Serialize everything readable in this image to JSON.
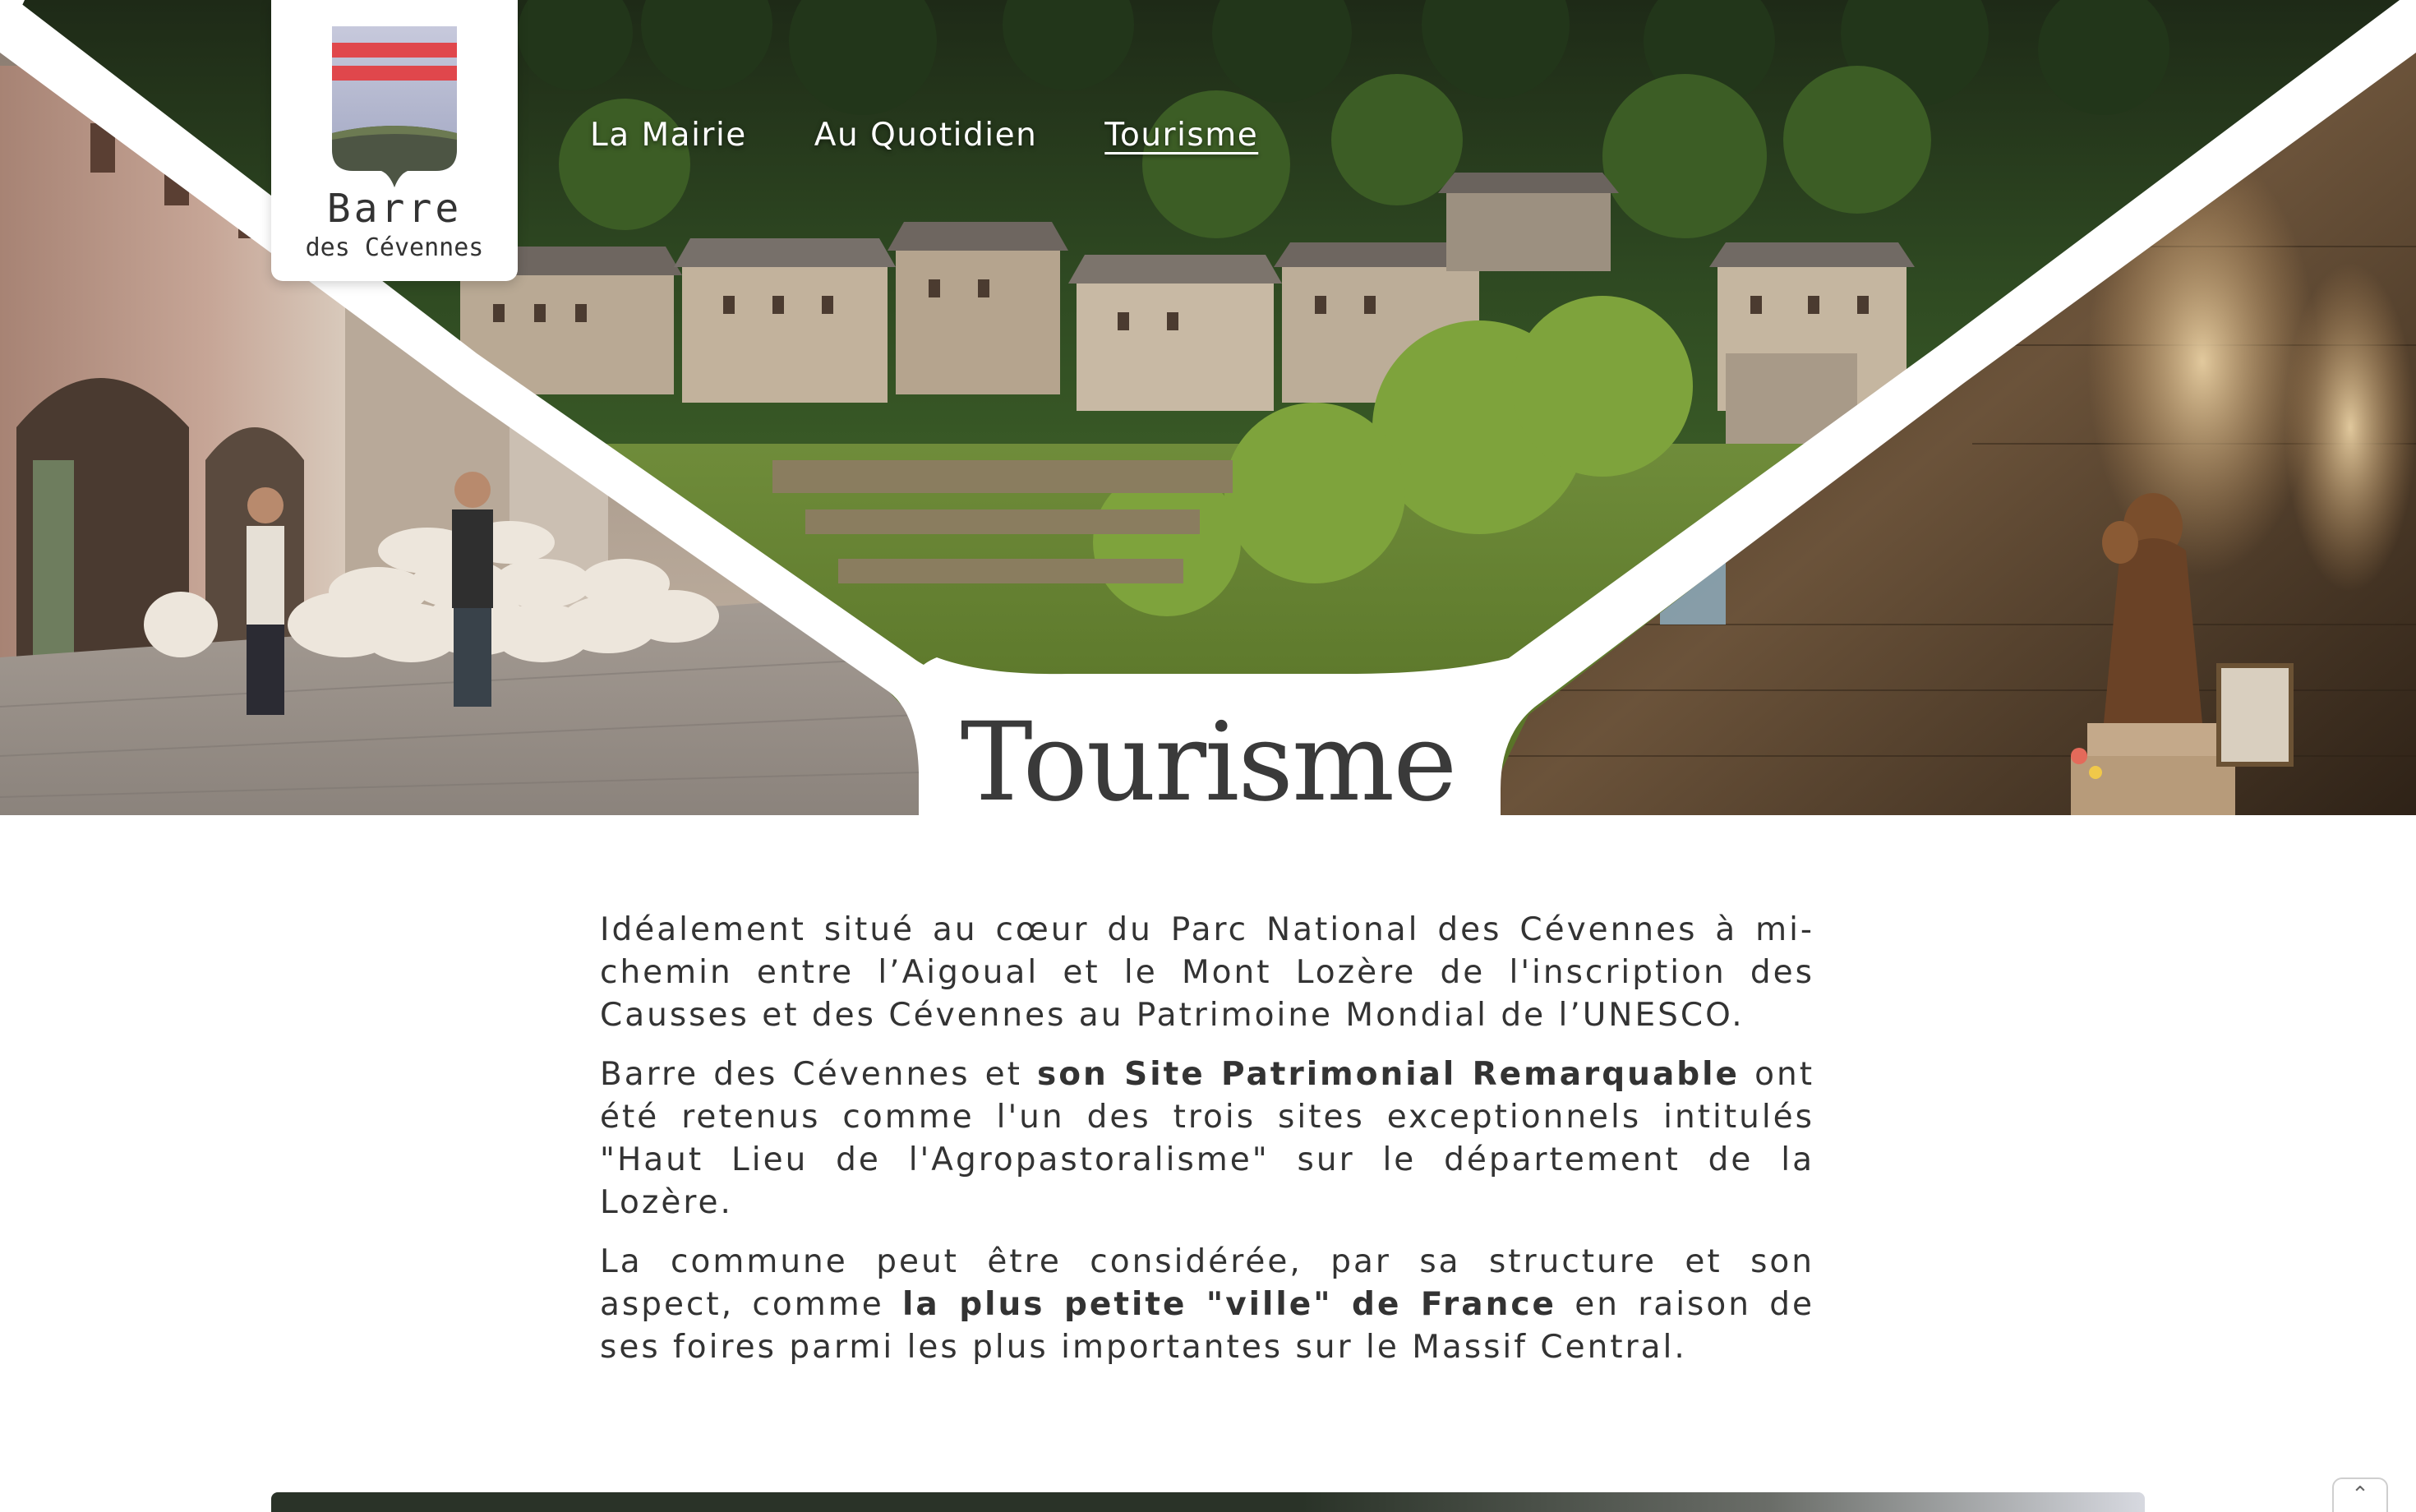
{
  "logo": {
    "title": "Barre",
    "subtitle": "des Cévennes",
    "colors": {
      "stripe": "#e0474c",
      "sky": "#aab0cc",
      "land": "#4d5544"
    }
  },
  "nav": {
    "items": [
      {
        "label": "La Mairie",
        "active": false
      },
      {
        "label": "Au Quotidien",
        "active": false
      },
      {
        "label": "Tourisme",
        "active": true
      }
    ]
  },
  "hero": {
    "images": {
      "left": "sheep-herd-street-photo",
      "center": "village-hillside-photo",
      "right": "church-statue-photo"
    }
  },
  "page": {
    "title": "Tourisme"
  },
  "content": {
    "p1": "Idéalement situé au cœur du Parc National des Cévennes à mi-chemin entre l’Aigoual et le Mont Lozère de l'inscription des Causses et des Cévennes au Patrimoine Mondial de l’UNESCO.",
    "p2_before": "Barre des Cévennes et ",
    "p2_bold": "son Site Patrimonial Remarquable",
    "p2_after": " ont été retenus comme l'un des trois sites exceptionnels intitulés \"Haut Lieu de l'Agropastoralisme\" sur le département de la Lozère.",
    "p3_before": "La commune  peut être considérée, par sa structure et son aspect, comme ",
    "p3_bold": "la plus petite \"ville\" de France",
    "p3_after": " en raison de ses foires parmi les plus importantes sur le Massif Central."
  },
  "scroll_top": {
    "icon": "chevron-up-icon",
    "glyph": "⌃"
  }
}
